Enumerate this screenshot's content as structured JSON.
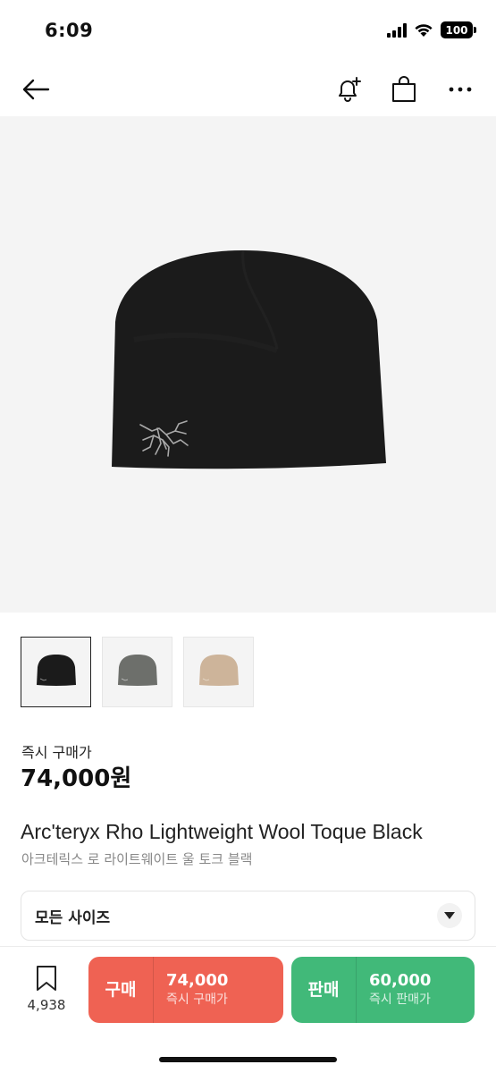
{
  "status_bar": {
    "time": "6:09",
    "battery": "100"
  },
  "nav": {
    "icons": [
      "back-arrow-icon",
      "bell-plus-icon",
      "shopping-bag-icon",
      "more-horizontal-icon"
    ]
  },
  "product": {
    "image_subject": "beanie",
    "colors": {
      "background": "#f4f4f4",
      "beanie": "#1b1b1b",
      "logo": "#a8a8a8"
    },
    "thumbnails": [
      {
        "color": "#1b1b1b",
        "selected": true
      },
      {
        "color": "#6d6f6b",
        "selected": false
      },
      {
        "color": "#cdb49a",
        "selected": false
      }
    ],
    "price_label": "즉시 구매가",
    "price": "74,000원",
    "title_en": "Arc'teryx Rho Lightweight Wool Toque Black",
    "title_ko": "아크테릭스 로 라이트웨이트 울 토크 블랙"
  },
  "size_select": {
    "label": "모든 사이즈",
    "icon": "chevron-down-icon"
  },
  "bottom_bar": {
    "bookmark_count": "4,938",
    "buy": {
      "label": "구매",
      "price": "74,000",
      "sub": "즉시 구매가",
      "color": "#ef6253"
    },
    "sell": {
      "label": "판매",
      "price": "60,000",
      "sub": "즉시 판매가",
      "color": "#41b979"
    }
  }
}
